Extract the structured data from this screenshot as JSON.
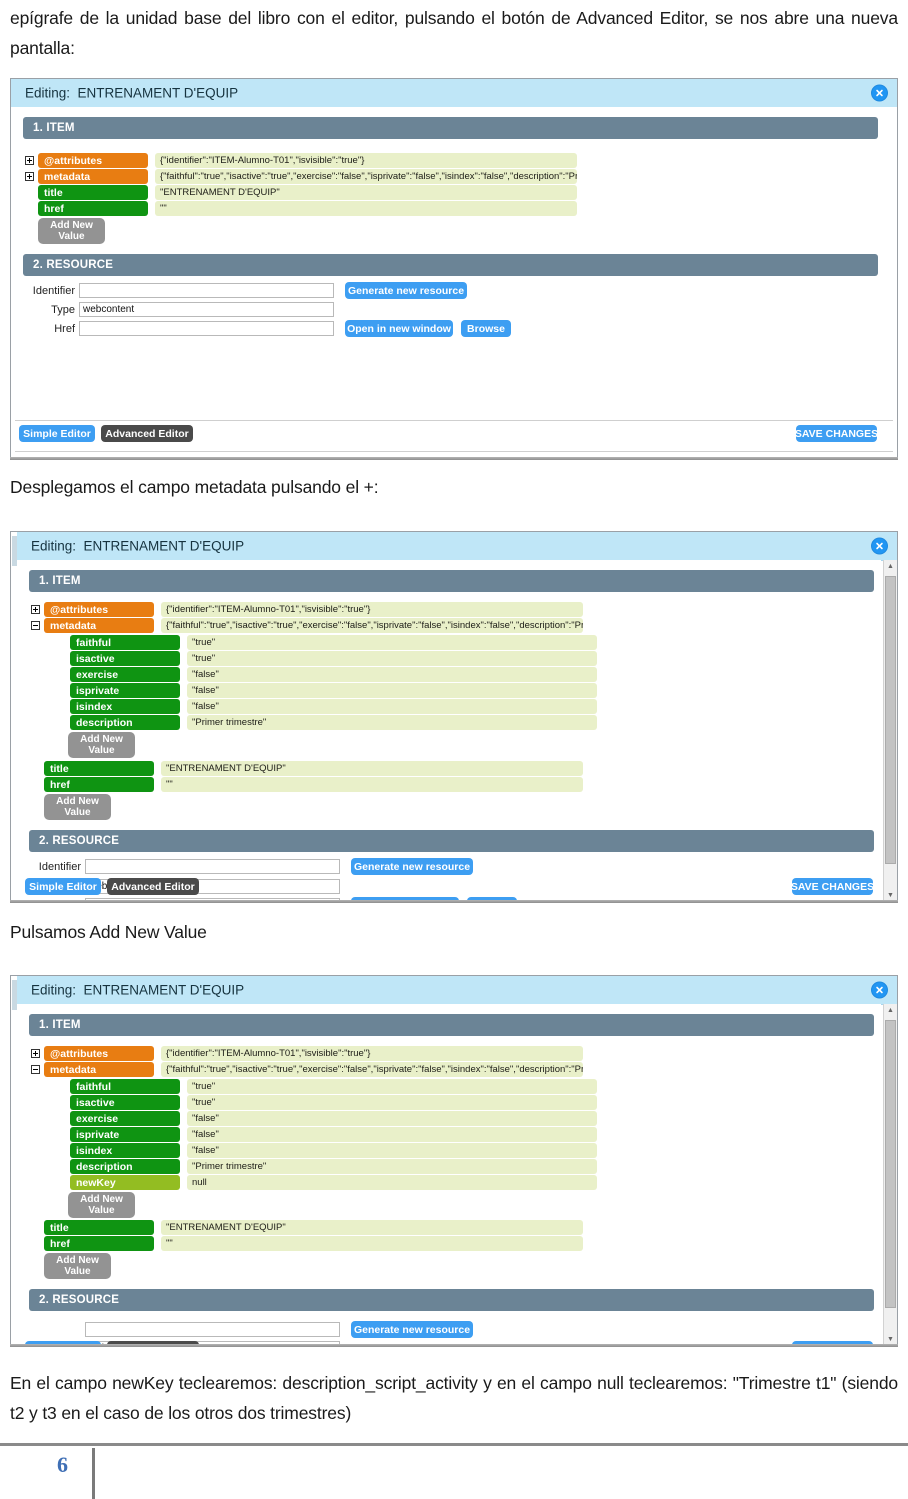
{
  "document": {
    "page_number": "6",
    "paragraphs": {
      "intro": "epígrafe de la unidad base del libro con el editor, pulsando el botón de Advanced Editor, se nos abre una nueva pantalla:",
      "between_1_2": "Desplegamos el campo metadata pulsando el +:",
      "between_2_3": "Pulsamos Add New Value",
      "closing": "En el campo newKey teclearemos: description_script_activity y en el campo null teclearemos: \"Trimestre t1\" (siendo t2 y t3 en el caso de los otros dos trimestres)"
    }
  },
  "dialog": {
    "title_prefix": "Editing:",
    "title_value": "ENTRENAMENT D'EQUIP",
    "close_icon": "close-circle-icon",
    "sections": {
      "item": "1. ITEM",
      "resource": "2. RESOURCE"
    },
    "add_new_value": {
      "line1": "Add New",
      "line2": "Value"
    },
    "tree_collapsed": [
      {
        "key": "@attributes",
        "value": "{\"identifier\":\"ITEM-Alumno-T01\",\"isvisible\":\"true\"}",
        "type": "orange",
        "expander": "plus"
      },
      {
        "key": "metadata",
        "value": "{\"faithful\":\"true\",\"isactive\":\"true\",\"exercise\":\"false\",\"isprivate\":\"false\",\"isindex\":\"false\",\"description\":\"Prim",
        "type": "orange",
        "expander": "plus"
      },
      {
        "key": "title",
        "value": "\"ENTRENAMENT D'EQUIP\"",
        "type": "green",
        "expander": "none"
      },
      {
        "key": "href",
        "value": "\"\"",
        "type": "green",
        "expander": "none"
      }
    ],
    "tree_expanded_children": [
      {
        "key": "faithful",
        "value": "\"true\"",
        "type": "green"
      },
      {
        "key": "isactive",
        "value": "\"true\"",
        "type": "green"
      },
      {
        "key": "exercise",
        "value": "\"false\"",
        "type": "green"
      },
      {
        "key": "isprivate",
        "value": "\"false\"",
        "type": "green"
      },
      {
        "key": "isindex",
        "value": "\"false\"",
        "type": "green"
      },
      {
        "key": "description",
        "value": "\"Primer trimestre\"",
        "type": "green"
      }
    ],
    "new_key_row": {
      "key": "newKey",
      "value": "null",
      "type": "olive"
    },
    "resource_form": {
      "identifier_label": "Identifier",
      "identifier_value": "",
      "type_label": "Type",
      "type_value": "webcontent",
      "href_label": "Href",
      "href_value": "",
      "generate_button": "Generate new resource",
      "open_button": "Open in new window",
      "browse_button": "Browse"
    },
    "footer": {
      "simple_editor": "Simple Editor",
      "advanced_editor": "Advanced Editor",
      "save_changes": "SAVE CHANGES"
    }
  },
  "colors": {
    "titlebar": "#bfe6f7",
    "section_header": "#6b8496",
    "chip_orange": "#e87d12",
    "chip_green": "#0f9412",
    "chip_olive": "#93bd22",
    "value_bg": "#e9f0c9",
    "button_blue": "#3d9ef2",
    "button_dark": "#4a4a4a",
    "button_gray": "#939393",
    "page_number": "#3f6fb5"
  }
}
